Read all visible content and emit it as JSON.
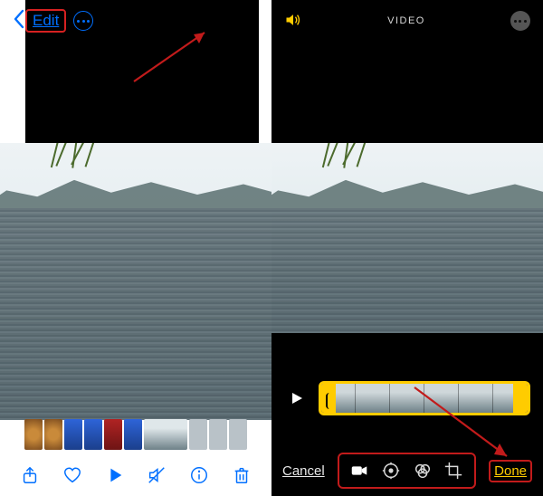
{
  "left": {
    "edit_label": "Edit",
    "toolbar": {
      "share": "share",
      "favorite": "favorite",
      "play": "play",
      "mute": "mute",
      "info": "info",
      "trash": "trash"
    }
  },
  "right": {
    "title": "VIDEO",
    "cancel_label": "Cancel",
    "done_label": "Done",
    "tools": {
      "video": "video",
      "adjust": "adjust",
      "filters": "filters",
      "crop": "crop"
    }
  },
  "colors": {
    "ios_blue": "#006fff",
    "ios_yellow": "#ffcc00",
    "annotation_red": "#c21b1b"
  }
}
